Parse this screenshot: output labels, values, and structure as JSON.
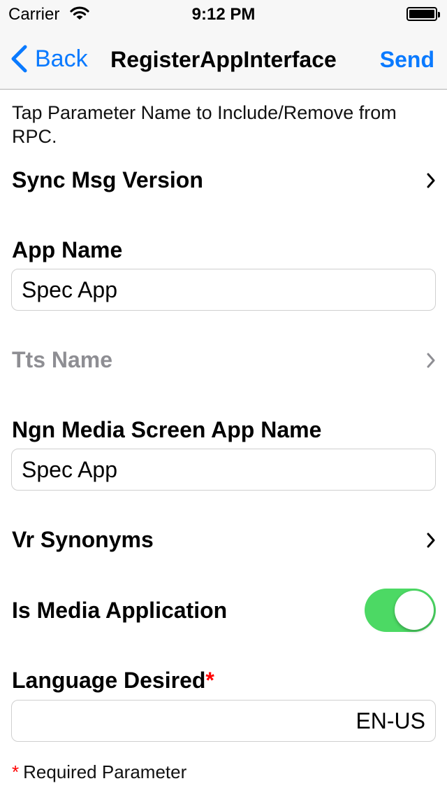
{
  "status_bar": {
    "carrier": "Carrier",
    "time": "9:12 PM"
  },
  "nav": {
    "back_label": "Back",
    "title": "RegisterAppInterface",
    "action_label": "Send",
    "tint_color": "#0a7aff"
  },
  "instructions": "Tap Parameter Name to Include/Remove from RPC.",
  "rows": {
    "sync_msg_version": {
      "label": "Sync Msg Version"
    },
    "app_name": {
      "label": "App Name",
      "value": "Spec App"
    },
    "tts_name": {
      "label": "Tts Name"
    },
    "ngn_media_screen_app_name": {
      "label": "Ngn Media Screen App Name",
      "value": "Spec App"
    },
    "vr_synonyms": {
      "label": "Vr Synonyms"
    },
    "is_media_application": {
      "label": "Is Media Application",
      "on": true,
      "on_color": "#4cd964"
    },
    "language_desired": {
      "label": "Language Desired",
      "required_mark": "*",
      "value": "EN-US"
    }
  },
  "footnote": {
    "mark": "*",
    "text": "Required Parameter"
  }
}
